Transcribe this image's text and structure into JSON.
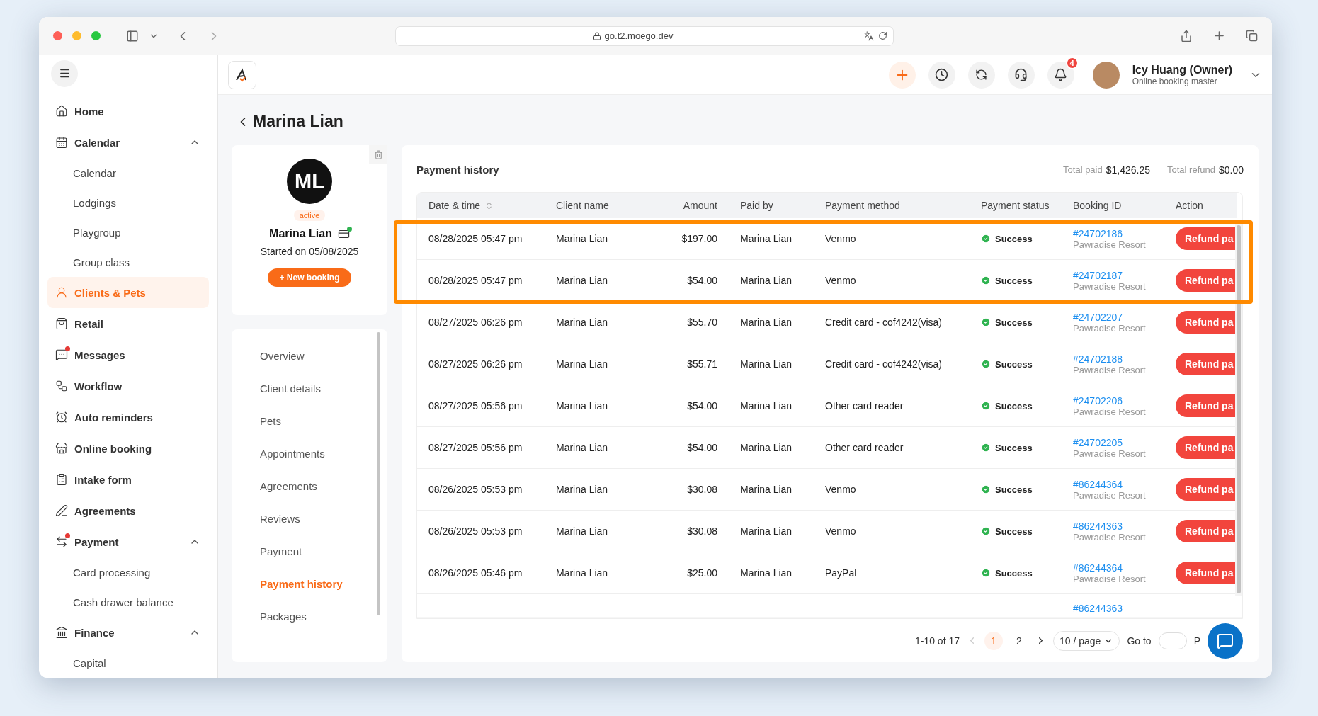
{
  "browser": {
    "url": "go.t2.moego.dev"
  },
  "header": {
    "notifications": "4",
    "user": {
      "name": "Icy Huang (Owner)",
      "role": "Online booking master"
    }
  },
  "sidebar": {
    "items": [
      {
        "label": "Home",
        "selected": false,
        "unread": false
      },
      {
        "label": "Calendar",
        "selected": false,
        "unread": false,
        "expanded": true,
        "children": [
          {
            "label": "Calendar",
            "selected": false
          },
          {
            "label": "Lodgings",
            "selected": false
          },
          {
            "label": "Playgroup",
            "selected": false
          },
          {
            "label": "Group class",
            "selected": false
          }
        ]
      },
      {
        "label": "Clients & Pets",
        "selected": true,
        "unread": false
      },
      {
        "label": "Retail",
        "selected": false,
        "unread": false
      },
      {
        "label": "Messages",
        "selected": false,
        "unread": true
      },
      {
        "label": "Workflow",
        "selected": false,
        "unread": false
      },
      {
        "label": "Auto reminders",
        "selected": false,
        "unread": false
      },
      {
        "label": "Online booking",
        "selected": false,
        "unread": false
      },
      {
        "label": "Intake form",
        "selected": false,
        "unread": false
      },
      {
        "label": "Agreements",
        "selected": false,
        "unread": false
      },
      {
        "label": "Payment",
        "selected": false,
        "unread": true,
        "expanded": true,
        "children": [
          {
            "label": "Card processing",
            "selected": false
          },
          {
            "label": "Cash drawer balance",
            "selected": false
          }
        ]
      },
      {
        "label": "Finance",
        "selected": false,
        "unread": false,
        "expanded": true,
        "children": [
          {
            "label": "Capital",
            "selected": false
          }
        ]
      }
    ]
  },
  "page": {
    "title": "Marina Lian"
  },
  "client": {
    "initials": "ML",
    "status": "active",
    "name": "Marina Lian",
    "card_on_file": true,
    "started": "Started on 05/08/2025",
    "new_booking": "+ New booking"
  },
  "client_nav": [
    {
      "label": "Overview",
      "selected": false
    },
    {
      "label": "Client details",
      "selected": false
    },
    {
      "label": "Pets",
      "selected": false
    },
    {
      "label": "Appointments",
      "selected": false
    },
    {
      "label": "Agreements",
      "selected": false
    },
    {
      "label": "Reviews",
      "selected": false
    },
    {
      "label": "Payment",
      "selected": false
    },
    {
      "label": "Payment history",
      "selected": true
    },
    {
      "label": "Packages",
      "selected": false
    }
  ],
  "payment_history": {
    "title": "Payment history",
    "total_paid_label": "Total paid",
    "total_paid": "$1,426.25",
    "total_refund_label": "Total refund",
    "total_refund": "$0.00",
    "columns": [
      "Date & time",
      "Client name",
      "Amount",
      "Paid by",
      "Payment method",
      "Payment status",
      "Booking ID",
      "Action"
    ],
    "rows": [
      {
        "date": "08/28/2025 05:47 pm",
        "client": "Marina Lian",
        "amount": "$197.00",
        "paid_by": "Marina Lian",
        "method": "Venmo",
        "status": "Success",
        "booking_id": "#24702186",
        "location": "Pawradise Resort",
        "action": "Refund pa",
        "highlighted": true
      },
      {
        "date": "08/28/2025 05:47 pm",
        "client": "Marina Lian",
        "amount": "$54.00",
        "paid_by": "Marina Lian",
        "method": "Venmo",
        "status": "Success",
        "booking_id": "#24702187",
        "location": "Pawradise Resort",
        "action": "Refund pa",
        "highlighted": true
      },
      {
        "date": "08/27/2025 06:26 pm",
        "client": "Marina Lian",
        "amount": "$55.70",
        "paid_by": "Marina Lian",
        "method": "Credit card - cof4242(visa)",
        "status": "Success",
        "booking_id": "#24702207",
        "location": "Pawradise Resort",
        "action": "Refund pa",
        "highlighted": false
      },
      {
        "date": "08/27/2025 06:26 pm",
        "client": "Marina Lian",
        "amount": "$55.71",
        "paid_by": "Marina Lian",
        "method": "Credit card - cof4242(visa)",
        "status": "Success",
        "booking_id": "#24702188",
        "location": "Pawradise Resort",
        "action": "Refund pa",
        "highlighted": false
      },
      {
        "date": "08/27/2025 05:56 pm",
        "client": "Marina Lian",
        "amount": "$54.00",
        "paid_by": "Marina Lian",
        "method": "Other card reader",
        "status": "Success",
        "booking_id": "#24702206",
        "location": "Pawradise Resort",
        "action": "Refund pa",
        "highlighted": false
      },
      {
        "date": "08/27/2025 05:56 pm",
        "client": "Marina Lian",
        "amount": "$54.00",
        "paid_by": "Marina Lian",
        "method": "Other card reader",
        "status": "Success",
        "booking_id": "#24702205",
        "location": "Pawradise Resort",
        "action": "Refund pa",
        "highlighted": false
      },
      {
        "date": "08/26/2025 05:53 pm",
        "client": "Marina Lian",
        "amount": "$30.08",
        "paid_by": "Marina Lian",
        "method": "Venmo",
        "status": "Success",
        "booking_id": "#86244364",
        "location": "Pawradise Resort",
        "action": "Refund pa",
        "highlighted": false
      },
      {
        "date": "08/26/2025 05:53 pm",
        "client": "Marina Lian",
        "amount": "$30.08",
        "paid_by": "Marina Lian",
        "method": "Venmo",
        "status": "Success",
        "booking_id": "#86244363",
        "location": "Pawradise Resort",
        "action": "Refund pa",
        "highlighted": false
      },
      {
        "date": "08/26/2025 05:46 pm",
        "client": "Marina Lian",
        "amount": "$25.00",
        "paid_by": "Marina Lian",
        "method": "PayPal",
        "status": "Success",
        "booking_id": "#86244364",
        "location": "Pawradise Resort",
        "action": "Refund pa",
        "highlighted": false
      },
      {
        "booking_id": "#86244363",
        "highlighted": false
      }
    ],
    "pagination": {
      "range": "1-10 of 17",
      "pages": [
        {
          "label": "1",
          "selected": true
        },
        {
          "label": "2",
          "selected": false
        }
      ],
      "prev_disabled": true,
      "page_size": "10 / page",
      "goto_label": "Go to",
      "goto_suffix": "P"
    }
  }
}
